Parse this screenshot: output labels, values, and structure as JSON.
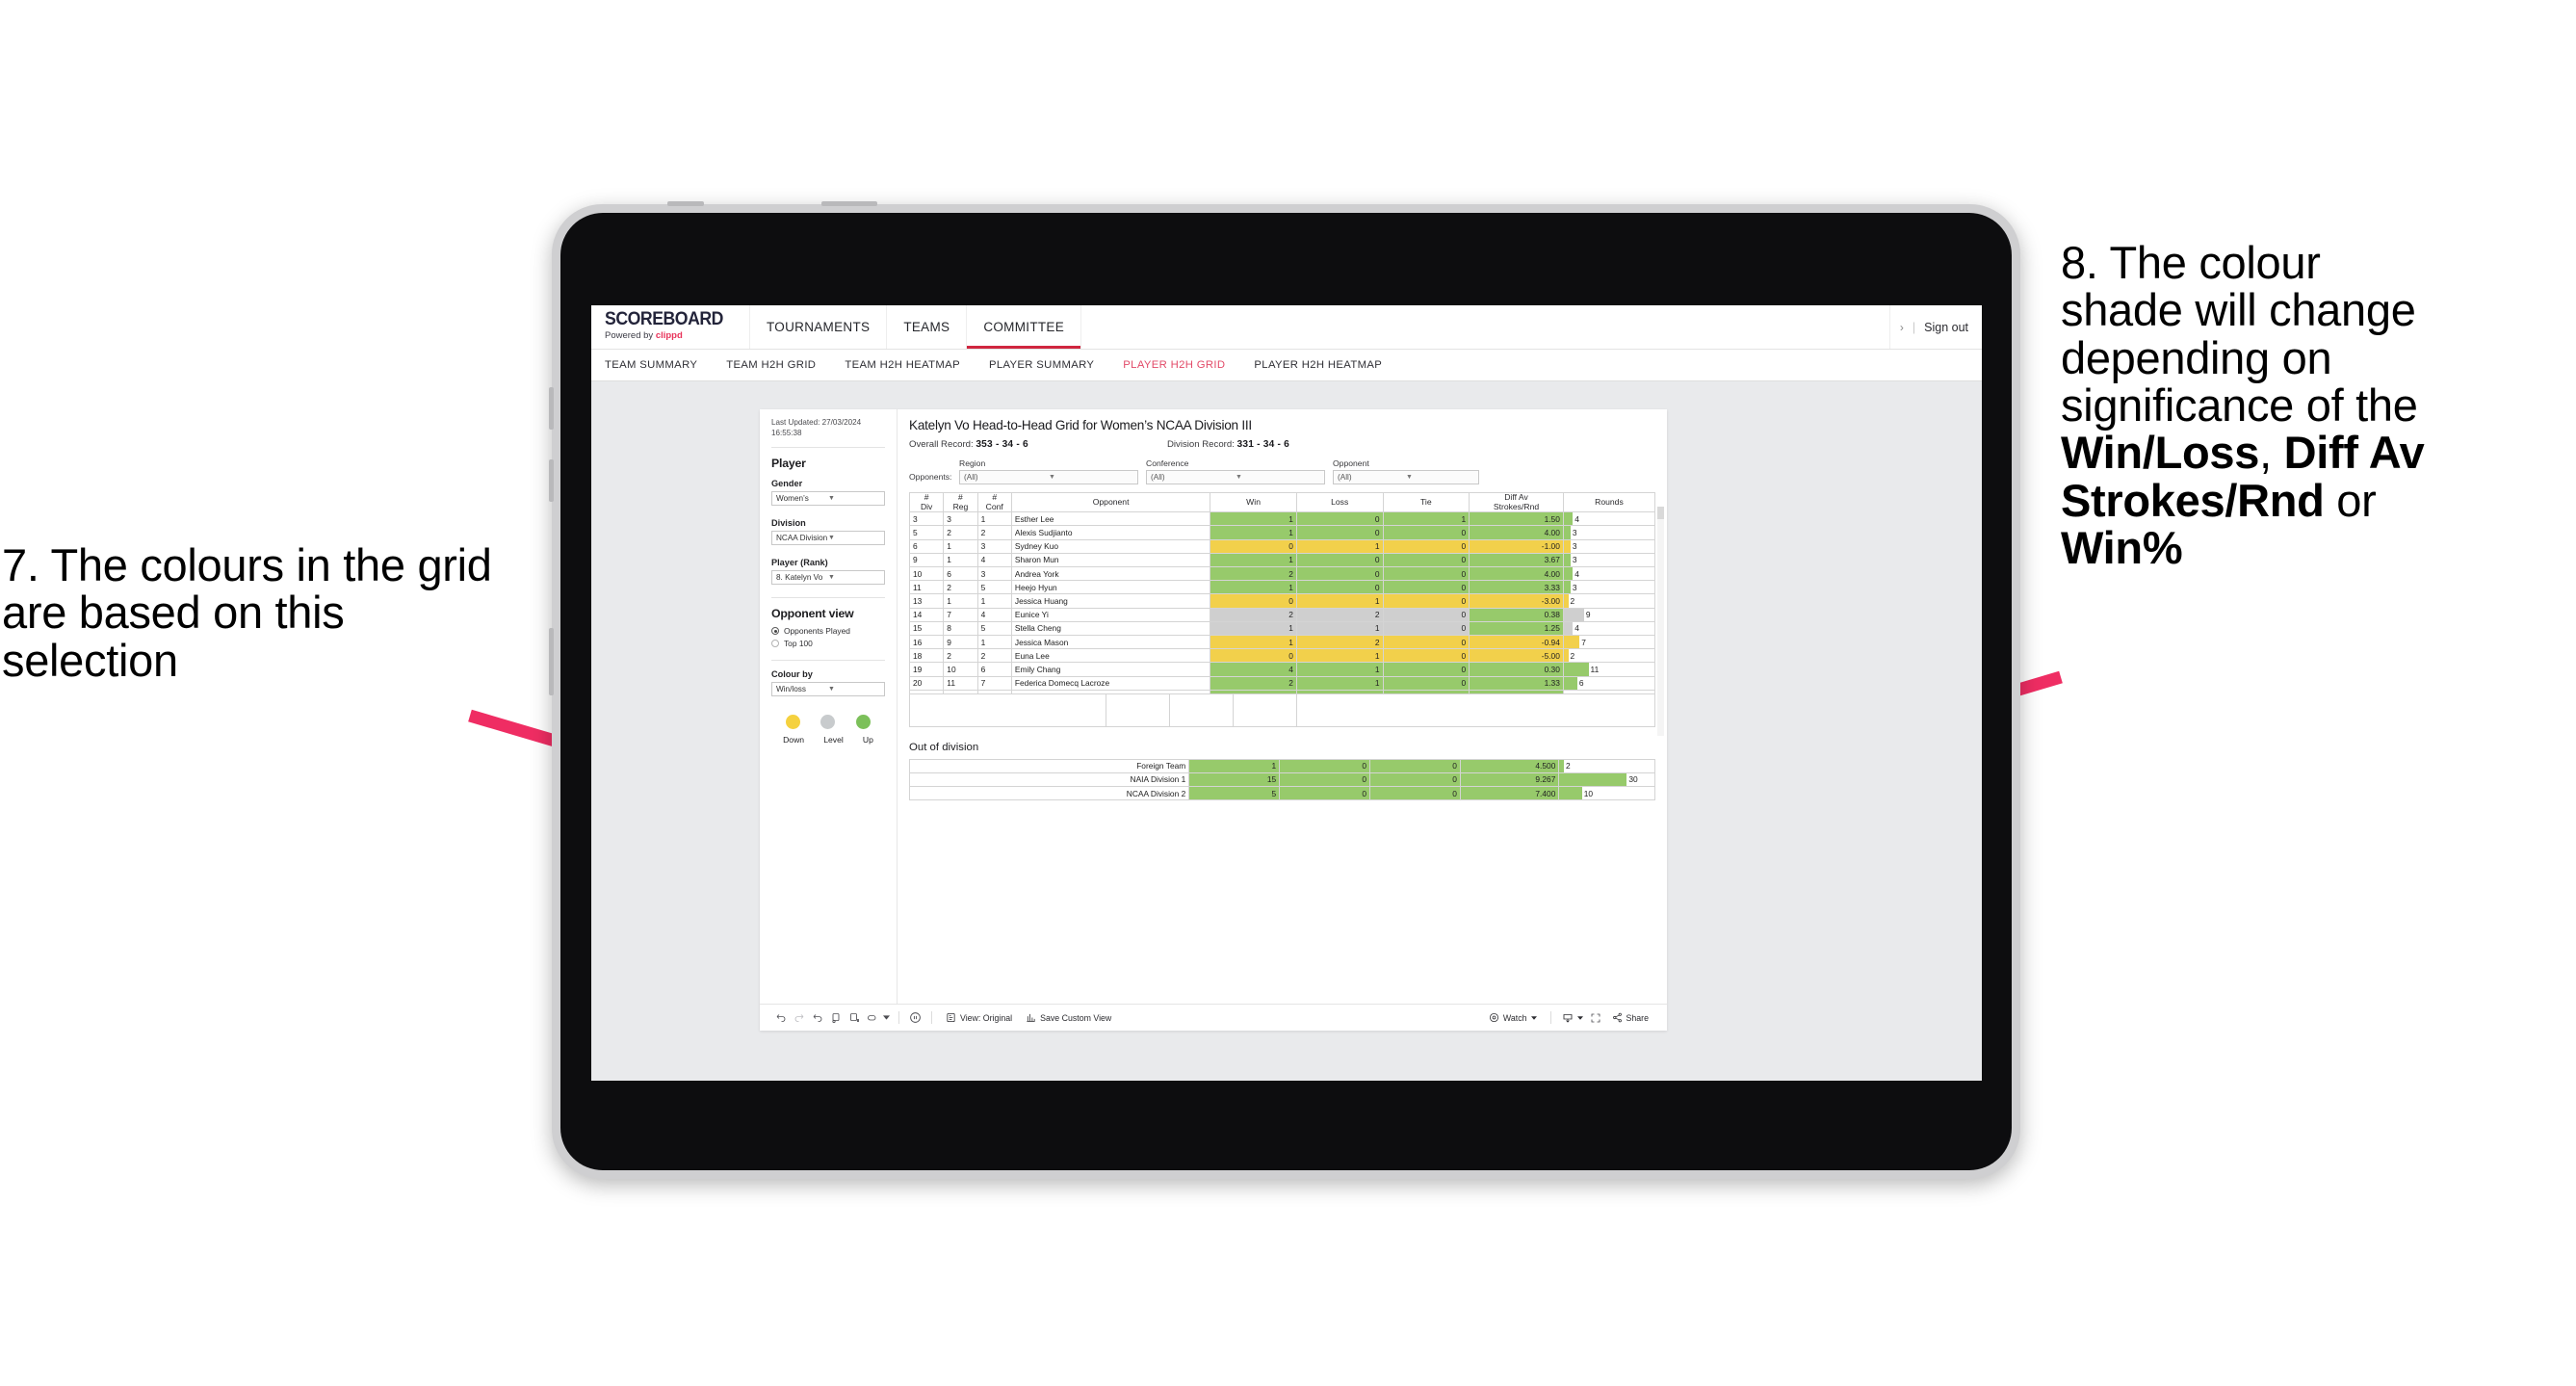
{
  "annotations": {
    "left": {
      "id": "7",
      "text": "7. The colours in the grid are based on this selection"
    },
    "right": {
      "id": "8",
      "line1": "8. The colour",
      "line2": "shade will change",
      "line3": "depending on",
      "line4": "significance of the",
      "bold1": "Win/Loss",
      "sep1": ", ",
      "bold2": "Diff Av Strokes/Rnd",
      "sep2": " or ",
      "bold3": "Win%"
    },
    "arrow_color": "#ef2d63"
  },
  "topnav": {
    "brand_title": "SCOREBOARD",
    "brand_sub_prefix": "Powered by ",
    "brand_sub_name": "clippd",
    "tabs": [
      {
        "label": "TOURNAMENTS",
        "active": false
      },
      {
        "label": "TEAMS",
        "active": false
      },
      {
        "label": "COMMITTEE",
        "active": true
      }
    ],
    "chevron": "›",
    "divider": "|",
    "signout": "Sign out",
    "active_color": "#d0263f"
  },
  "subnav": {
    "tabs": [
      {
        "label": "TEAM SUMMARY",
        "active": false
      },
      {
        "label": "TEAM H2H GRID",
        "active": false
      },
      {
        "label": "TEAM H2H HEATMAP",
        "active": false
      },
      {
        "label": "PLAYER SUMMARY",
        "active": false
      },
      {
        "label": "PLAYER H2H GRID",
        "active": true
      },
      {
        "label": "PLAYER H2H HEATMAP",
        "active": false
      }
    ],
    "active_color": "#e24a68"
  },
  "sidebar": {
    "last_updated": "Last Updated: 27/03/2024 16:55:38",
    "player_heading": "Player",
    "gender_label": "Gender",
    "gender_value": "Women’s",
    "division_label": "Division",
    "division_value": "NCAA Division III",
    "player_rank_label": "Player (Rank)",
    "player_rank_value": "8. Katelyn Vo",
    "opponent_view_heading": "Opponent view",
    "opponent_view_options": [
      {
        "label": "Opponents Played",
        "selected": true
      },
      {
        "label": "Top 100",
        "selected": false
      }
    ],
    "colour_by_label": "Colour by",
    "colour_by_value": "Win/loss",
    "legend": [
      {
        "label": "Down",
        "color": "#f5d13f"
      },
      {
        "label": "Level",
        "color": "#c8cbcd"
      },
      {
        "label": "Up",
        "color": "#7cc05a"
      }
    ]
  },
  "main": {
    "title": "Katelyn Vo Head-to-Head Grid for Women’s NCAA Division III",
    "overall_record_label": "Overall Record: ",
    "overall_record_value": "353 -  34 - 6",
    "division_record_label": "Division Record: ",
    "division_record_value": "331 -  34 - 6",
    "opponents_label": "Opponents:",
    "filters": [
      {
        "label": "Region",
        "value": "(All)"
      },
      {
        "label": "Conference",
        "value": "(All)"
      },
      {
        "label": "Opponent",
        "value": "(All)"
      }
    ],
    "out_of_division_heading": "Out of division"
  },
  "chart_data": {
    "type": "table",
    "title": "Katelyn Vo Head-to-Head Grid for Women’s NCAA Division III",
    "columns": [
      "# Div",
      "# Reg",
      "# Conf",
      "Opponent",
      "Win",
      "Loss",
      "Tie",
      "Diff Av Strokes/Rnd",
      "Rounds"
    ],
    "column_headers_two_line": {
      "div": [
        "#",
        "Div"
      ],
      "reg": [
        "#",
        "Reg"
      ],
      "conf": [
        "#",
        "Conf"
      ],
      "opponent": [
        "Opponent"
      ],
      "win": [
        "Win"
      ],
      "loss": [
        "Loss"
      ],
      "tie": [
        "Tie"
      ],
      "diff": [
        "Diff Av",
        "Strokes/Rnd"
      ],
      "rounds": [
        "Rounds"
      ]
    },
    "rounds_axis_max": 30,
    "rows": [
      {
        "div": "3",
        "reg": "3",
        "conf": "1",
        "opponent": "Esther Lee",
        "win": "1",
        "loss": "0",
        "tie": "1",
        "diff": "1.50",
        "rounds": "4",
        "rounds_num": 4,
        "shade": "green"
      },
      {
        "div": "5",
        "reg": "2",
        "conf": "2",
        "opponent": "Alexis Sudjianto",
        "win": "1",
        "loss": "0",
        "tie": "0",
        "diff": "4.00",
        "rounds": "3",
        "rounds_num": 3,
        "shade": "green"
      },
      {
        "div": "6",
        "reg": "1",
        "conf": "3",
        "opponent": "Sydney Kuo",
        "win": "0",
        "loss": "1",
        "tie": "0",
        "diff": "-1.00",
        "rounds": "3",
        "rounds_num": 3,
        "shade": "yellow"
      },
      {
        "div": "9",
        "reg": "1",
        "conf": "4",
        "opponent": "Sharon Mun",
        "win": "1",
        "loss": "0",
        "tie": "0",
        "diff": "3.67",
        "rounds": "3",
        "rounds_num": 3,
        "shade": "green"
      },
      {
        "div": "10",
        "reg": "6",
        "conf": "3",
        "opponent": "Andrea York",
        "win": "2",
        "loss": "0",
        "tie": "0",
        "diff": "4.00",
        "rounds": "4",
        "rounds_num": 4,
        "shade": "green"
      },
      {
        "div": "11",
        "reg": "2",
        "conf": "5",
        "opponent": "Heejo Hyun",
        "win": "1",
        "loss": "0",
        "tie": "0",
        "diff": "3.33",
        "rounds": "3",
        "rounds_num": 3,
        "shade": "green"
      },
      {
        "div": "13",
        "reg": "1",
        "conf": "1",
        "opponent": "Jessica Huang",
        "win": "0",
        "loss": "1",
        "tie": "0",
        "diff": "-3.00",
        "rounds": "2",
        "rounds_num": 2,
        "shade": "yellow"
      },
      {
        "div": "14",
        "reg": "7",
        "conf": "4",
        "opponent": "Eunice Yi",
        "win": "2",
        "loss": "2",
        "tie": "0",
        "diff": "0.38",
        "rounds": "9",
        "rounds_num": 9,
        "shade": "grey",
        "diff_shade": "green"
      },
      {
        "div": "15",
        "reg": "8",
        "conf": "5",
        "opponent": "Stella Cheng",
        "win": "1",
        "loss": "1",
        "tie": "0",
        "diff": "1.25",
        "rounds": "4",
        "rounds_num": 4,
        "shade": "grey",
        "diff_shade": "green"
      },
      {
        "div": "16",
        "reg": "9",
        "conf": "1",
        "opponent": "Jessica Mason",
        "win": "1",
        "loss": "2",
        "tie": "0",
        "diff": "-0.94",
        "rounds": "7",
        "rounds_num": 7,
        "shade": "yellow"
      },
      {
        "div": "18",
        "reg": "2",
        "conf": "2",
        "opponent": "Euna Lee",
        "win": "0",
        "loss": "1",
        "tie": "0",
        "diff": "-5.00",
        "rounds": "2",
        "rounds_num": 2,
        "shade": "yellow"
      },
      {
        "div": "19",
        "reg": "10",
        "conf": "6",
        "opponent": "Emily Chang",
        "win": "4",
        "loss": "1",
        "tie": "0",
        "diff": "0.30",
        "rounds": "11",
        "rounds_num": 11,
        "shade": "green"
      },
      {
        "div": "20",
        "reg": "11",
        "conf": "7",
        "opponent": "Federica Domecq Lacroze",
        "win": "2",
        "loss": "1",
        "tie": "0",
        "diff": "1.33",
        "rounds": "6",
        "rounds_num": 6,
        "shade": "green"
      }
    ],
    "out_of_division": {
      "heading": "Out of division",
      "rows": [
        {
          "name": "Foreign Team",
          "win": "1",
          "loss": "0",
          "tie": "0",
          "diff": "4.500",
          "rounds": "2",
          "rounds_num": 2,
          "shade": "green"
        },
        {
          "name": "NAIA Division 1",
          "win": "15",
          "loss": "0",
          "tie": "0",
          "diff": "9.267",
          "rounds": "30",
          "rounds_num": 30,
          "shade": "green"
        },
        {
          "name": "NCAA Division 2",
          "win": "5",
          "loss": "0",
          "tie": "0",
          "diff": "7.400",
          "rounds": "10",
          "rounds_num": 10,
          "shade": "green"
        }
      ]
    },
    "shade_colors": {
      "green": "#97ca6b",
      "yellow": "#f2d04b",
      "grey": "#cfcfcf"
    }
  },
  "toolbar": {
    "view_label": "View: Original",
    "save_label": "Save Custom View",
    "watch_label": "Watch",
    "share_label": "Share"
  }
}
